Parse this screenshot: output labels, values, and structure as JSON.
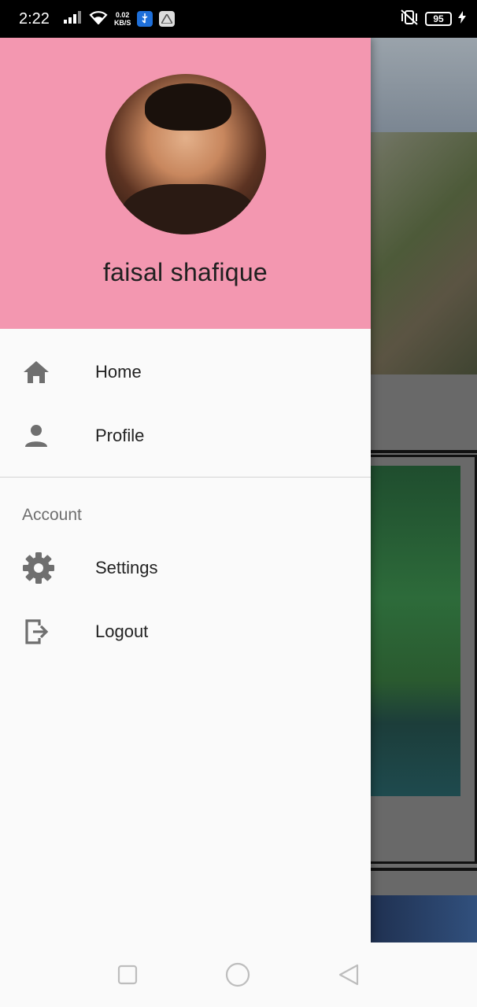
{
  "status_bar": {
    "time": "2:22",
    "net_speed_value": "0.02",
    "net_speed_unit": "KB/S",
    "battery": "95"
  },
  "drawer": {
    "header": {
      "user_name": "faisal shafique",
      "header_color": "#f397b0"
    },
    "items": [
      {
        "label": "Home",
        "icon": "home-icon"
      },
      {
        "label": "Profile",
        "icon": "person-icon"
      }
    ],
    "section_title": "Account",
    "account_items": [
      {
        "label": "Settings",
        "icon": "gear-icon"
      },
      {
        "label": "Logout",
        "icon": "logout-icon"
      }
    ]
  },
  "nav_bar": {
    "buttons": [
      "recents-button",
      "home-button",
      "back-button"
    ]
  },
  "colors": {
    "drawer_header": "#f397b0",
    "drawer_background": "#fafafa",
    "icon_grey": "#6f6f6f"
  }
}
